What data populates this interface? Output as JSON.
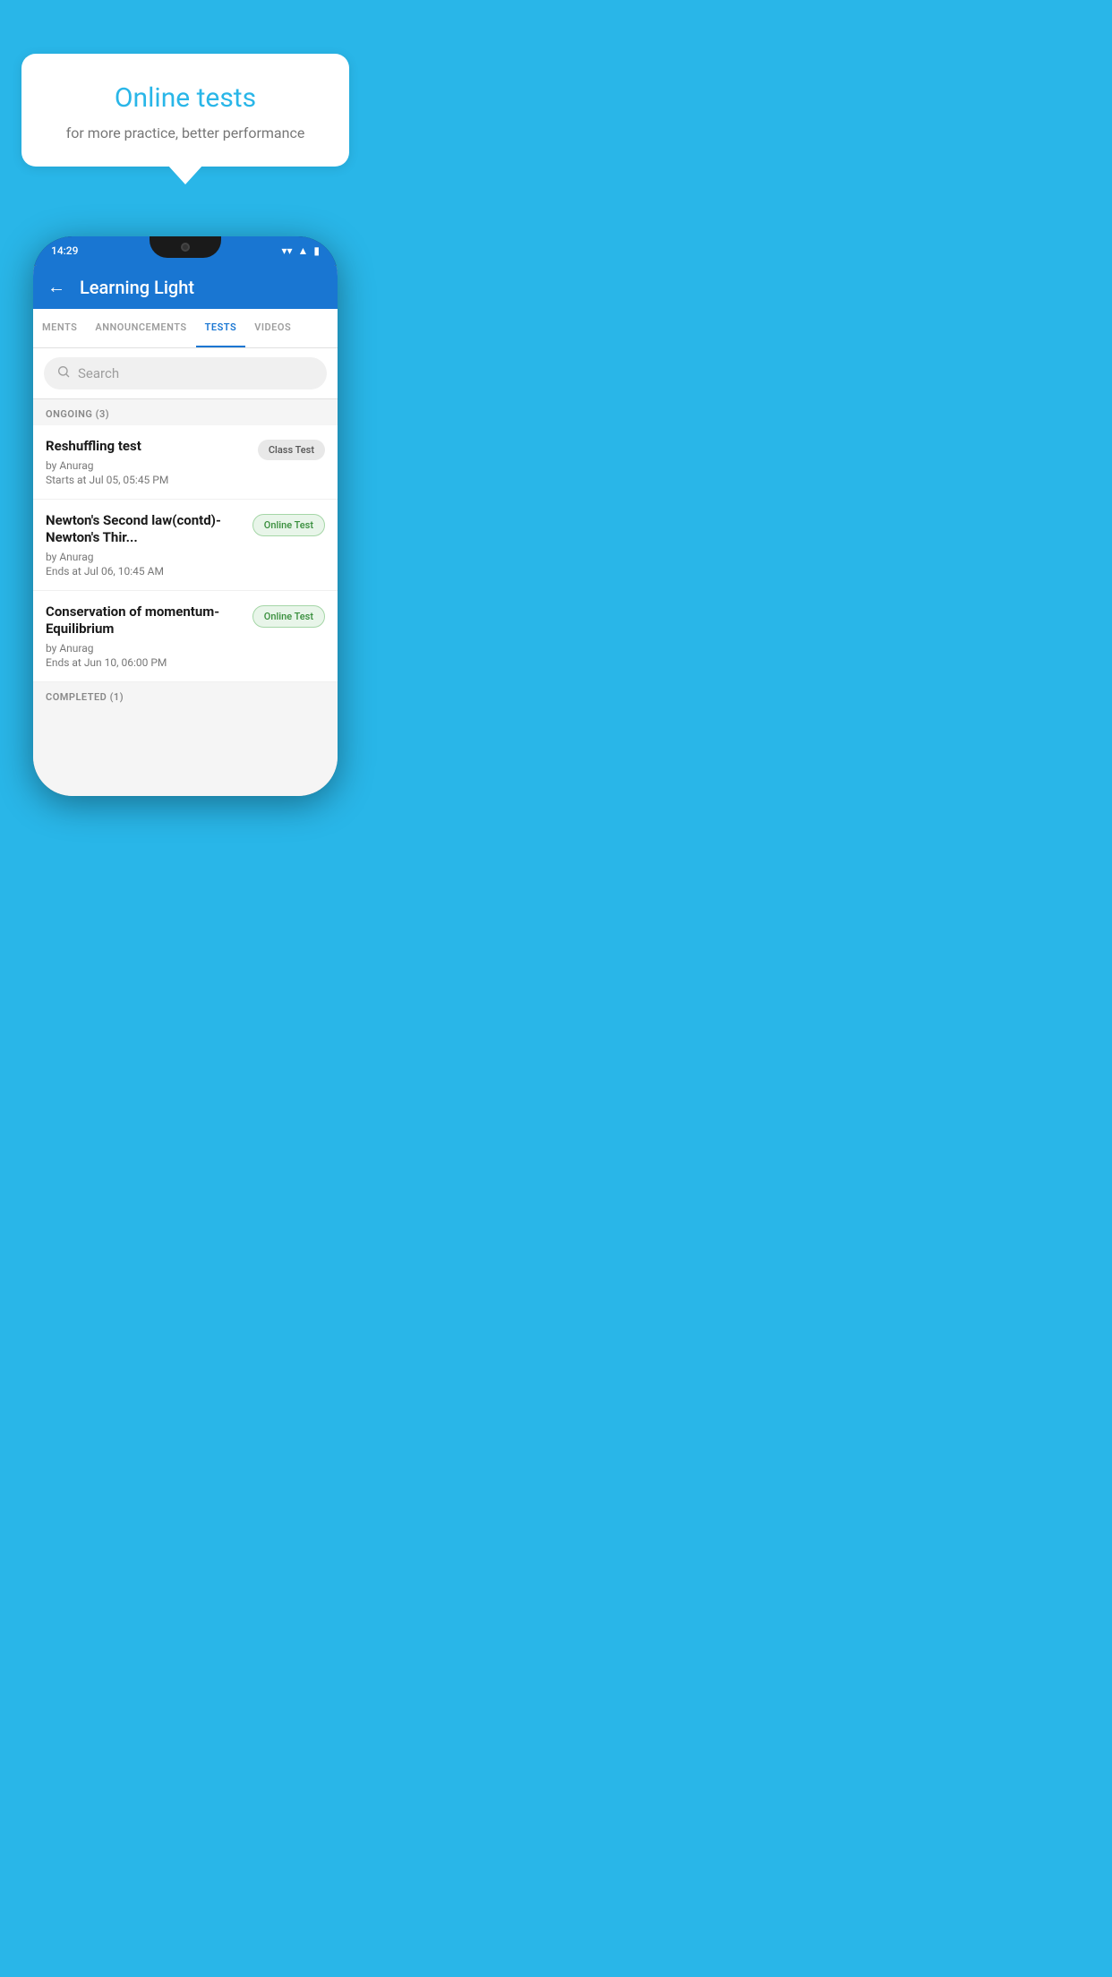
{
  "promo": {
    "title": "Online tests",
    "subtitle": "for more practice, better performance"
  },
  "app": {
    "title": "Learning Light",
    "back_label": "←"
  },
  "status_bar": {
    "time": "14:29",
    "wifi": "▾",
    "signal": "▲",
    "battery": "▮"
  },
  "tabs": [
    {
      "id": "ments",
      "label": "MENTS",
      "active": false
    },
    {
      "id": "announcements",
      "label": "ANNOUNCEMENTS",
      "active": false
    },
    {
      "id": "tests",
      "label": "TESTS",
      "active": true
    },
    {
      "id": "videos",
      "label": "VIDEOS",
      "active": false
    }
  ],
  "search": {
    "placeholder": "Search"
  },
  "ongoing_section": {
    "label": "ONGOING (3)"
  },
  "tests": [
    {
      "id": 1,
      "title": "Reshuffling test",
      "author": "by Anurag",
      "date": "Starts at  Jul 05, 05:45 PM",
      "badge": "Class Test",
      "badge_type": "class"
    },
    {
      "id": 2,
      "title": "Newton's Second law(contd)-Newton's Thir...",
      "author": "by Anurag",
      "date": "Ends at  Jul 06, 10:45 AM",
      "badge": "Online Test",
      "badge_type": "online"
    },
    {
      "id": 3,
      "title": "Conservation of momentum-Equilibrium",
      "author": "by Anurag",
      "date": "Ends at  Jun 10, 06:00 PM",
      "badge": "Online Test",
      "badge_type": "online"
    }
  ],
  "completed_section": {
    "label": "COMPLETED (1)"
  }
}
